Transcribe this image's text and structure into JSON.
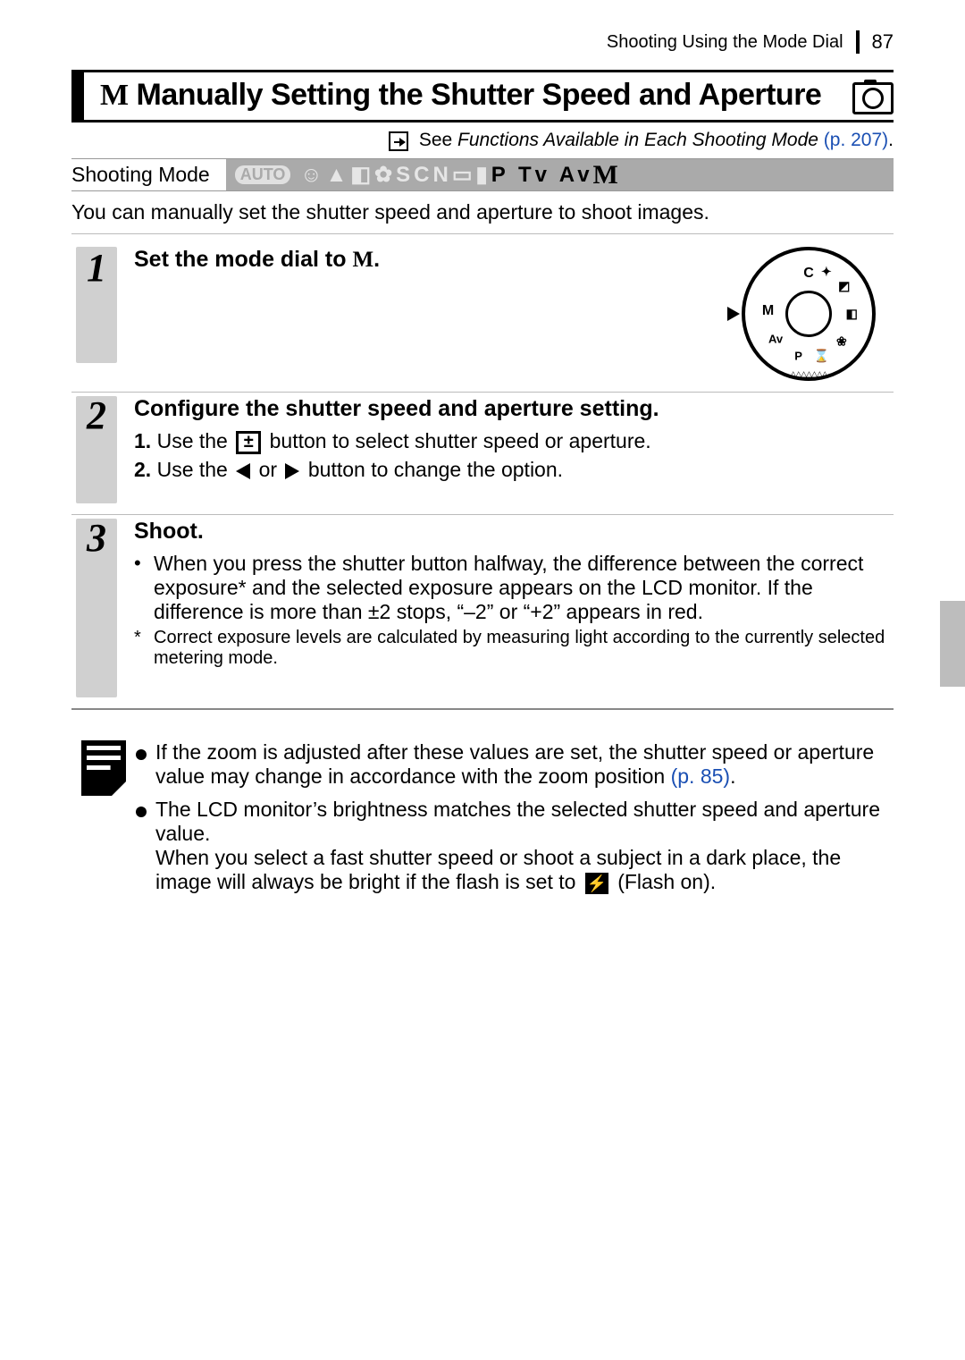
{
  "header": {
    "section_title": "Shooting Using the Mode Dial",
    "page_number": "87"
  },
  "title": {
    "mode_glyph": "M",
    "heading": "Manually Setting the Shutter Speed and Aperture"
  },
  "see_also": {
    "prefix": "See ",
    "italic_text": "Functions Available in Each Shooting Mode",
    "page_ref": " (p. 207)",
    "trailing": "."
  },
  "modebar": {
    "label": "Shooting Mode",
    "auto": "AUTO",
    "scn": "SCN",
    "modes_tail": "P Tv Av",
    "mode_m": "M"
  },
  "intro": "You can manually set the shutter speed and aperture to shoot images.",
  "steps": {
    "s1": {
      "num": "1",
      "heading_pre": "Set the mode dial to ",
      "heading_glyph": "M",
      "heading_post": "."
    },
    "dial": {
      "C": "C",
      "M": "M",
      "Av": "Av",
      "P": "P"
    },
    "s2": {
      "num": "2",
      "heading": "Configure the shutter speed and aperture setting.",
      "sub1_num": "1.",
      "sub1_a": "Use the ",
      "sub1_b": " button to select shutter speed or aperture.",
      "sub2_num": "2.",
      "sub2_a": "Use the ",
      "sub2_mid": " or ",
      "sub2_b": " button to change the option."
    },
    "s3": {
      "num": "3",
      "heading": "Shoot.",
      "bullet": "When you press the shutter button halfway, the difference between the correct exposure* and the selected exposure appears on the LCD monitor. If the difference is more than ±2 stops, “–2” or “+2” appears in red.",
      "footnote": "Correct exposure levels are calculated by measuring light according to the currently selected metering mode."
    }
  },
  "notice": {
    "n1_a": "If the zoom is adjusted after these values are set, the shutter speed or aperture value may change in accordance with the zoom position ",
    "n1_ref": "(p. 85)",
    "n1_b": ".",
    "n2_a": "The LCD monitor’s brightness matches the selected shutter speed and aperture value.",
    "n2_b": "When you select a fast shutter speed or shoot a subject in a dark place, the image will always be bright if the flash is set to ",
    "n2_flash_glyph": "⚡",
    "n2_c": " (Flash on)."
  }
}
